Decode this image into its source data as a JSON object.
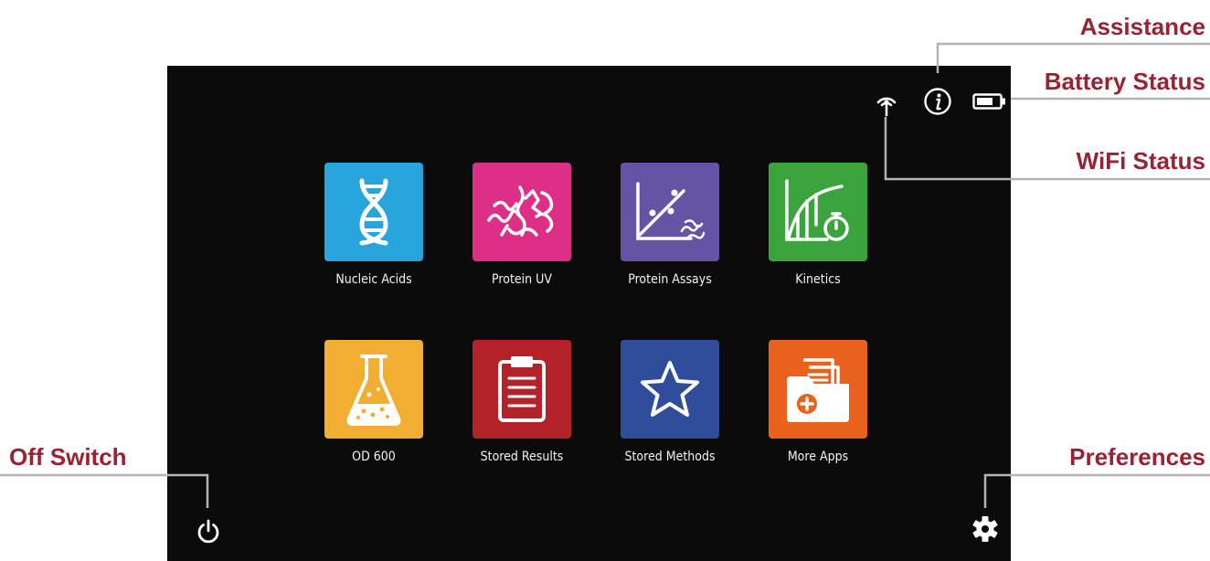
{
  "apps": [
    {
      "label": "Nucleic Acids",
      "icon": "dna-icon",
      "color": "#27a5dc"
    },
    {
      "label": "Protein UV",
      "icon": "protein-icon",
      "color": "#dd2f87"
    },
    {
      "label": "Protein Assays",
      "icon": "assay-plot-icon",
      "color": "#6554a6"
    },
    {
      "label": "Kinetics",
      "icon": "kinetics-timer-icon",
      "color": "#3aa33c"
    },
    {
      "label": "OD 600",
      "icon": "flask-icon",
      "color": "#f2ae33"
    },
    {
      "label": "Stored Results",
      "icon": "clipboard-icon",
      "color": "#b32228"
    },
    {
      "label": "Stored Methods",
      "icon": "star-icon",
      "color": "#304d9c"
    },
    {
      "label": "More Apps",
      "icon": "folder-add-icon",
      "color": "#e8621e"
    }
  ],
  "status_icons": [
    "wifi-icon",
    "info-icon",
    "battery-icon"
  ],
  "system_icons": [
    "power-icon",
    "gear-icon"
  ],
  "callouts": {
    "assistance": "Assistance",
    "battery_status": "Battery Status",
    "wifi_status": "WiFi Status",
    "off_switch": "Off Switch",
    "preferences": "Preferences"
  },
  "colors": {
    "screen_bg": "#0b0b0b",
    "callout_text": "#9a2235",
    "leader_line": "#b3b3b3"
  }
}
